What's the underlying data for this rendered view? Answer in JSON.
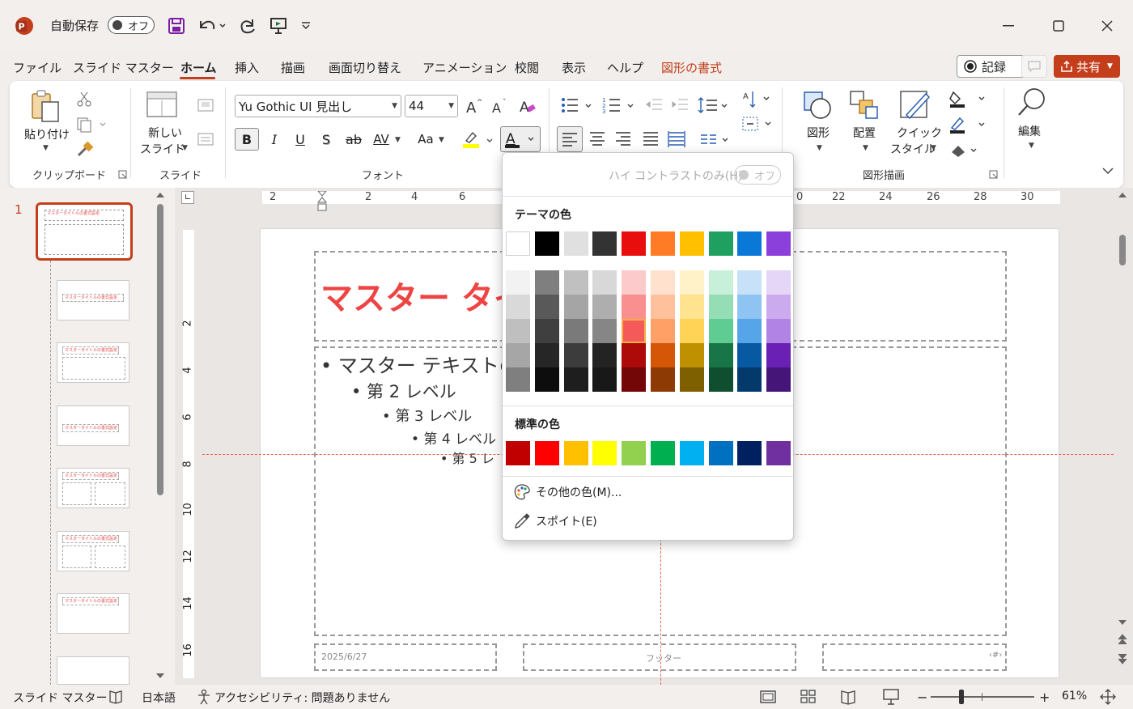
{
  "titlebar": {
    "autosave_label": "自動保存",
    "autosave_state": "オフ",
    "app_icon": "powerpoint-icon",
    "accent": "#c43e1c"
  },
  "menu": {
    "items": [
      "ファイル",
      "スライド マスター",
      "ホーム",
      "挿入",
      "描画",
      "画面切り替え",
      "アニメーション",
      "校閲",
      "表示",
      "ヘルプ",
      "図形の書式"
    ],
    "active": "ホーム",
    "record_label": "記録",
    "share_label": "共有"
  },
  "ribbon": {
    "clipboard": {
      "paste_label": "貼り付け",
      "group_label": "クリップボード"
    },
    "slide": {
      "new_slide_label_1": "新しい",
      "new_slide_label_2": "スライド",
      "group_label": "スライド"
    },
    "font": {
      "font_name": "Yu Gothic UI 見出し",
      "font_size": "44",
      "group_label": "フォント",
      "bold": "B",
      "italic": "I",
      "underline": "U",
      "shadow": "S",
      "strike": "ab",
      "spacing": "AV",
      "case": "Aa"
    },
    "drawing": {
      "shape_label": "図形",
      "arrange_label": "配置",
      "quick_style_1": "クイック",
      "quick_style_2": "スタイル",
      "group_label": "図形描画"
    },
    "edit": {
      "label": "編集"
    }
  },
  "thumbs": {
    "active_index": "1",
    "thumb_title": "マスタータイトルの書式設定"
  },
  "ruler": {
    "top": [
      "2",
      "2",
      "4",
      "6",
      "0",
      "22",
      "24",
      "26",
      "28",
      "30"
    ],
    "left": [
      "2",
      "4",
      "6",
      "8",
      "10",
      "12",
      "14",
      "16"
    ]
  },
  "slide": {
    "title": "マスター タイト",
    "body_l1": "• マスター テキストの書",
    "body_l2": "• 第 2 レベル",
    "body_l3": "• 第 3 レベル",
    "body_l4": "• 第 4 レベル",
    "body_l5": "• 第 5 レ",
    "date": "2025/6/27",
    "footer": "フッター",
    "page": "‹#›"
  },
  "popup": {
    "high_contrast_label": "ハイ コントラストのみ(H)",
    "high_contrast_state": "オフ",
    "theme_label": "テーマの色",
    "standard_label": "標準の色",
    "more_colors": "その他の色(M)...",
    "eyedropper": "スポイト(E)",
    "theme_top": [
      "#ffffff",
      "#000000",
      "#e0e0e0",
      "#333333",
      "#e80e0e",
      "#ff7b25",
      "#ffc000",
      "#20a060",
      "#0a78d7",
      "#8b3fdb"
    ],
    "theme_shades": [
      [
        "#f2f2f2",
        "#7f7f7f",
        "#c0c0c0",
        "#d8d8d8",
        "#fccaca",
        "#ffe1ce",
        "#fff1c8",
        "#c8efd9",
        "#c6e1f8",
        "#e5d5f6"
      ],
      [
        "#d9d9d9",
        "#595959",
        "#a5a5a5",
        "#aeaeae",
        "#f98f8f",
        "#ffc19b",
        "#ffe38f",
        "#94ddb5",
        "#8fc3f1",
        "#cbabed"
      ],
      [
        "#bfbfbf",
        "#3f3f3f",
        "#7a7a7a",
        "#868686",
        "#f55a5a",
        "#ffa167",
        "#ffd456",
        "#5fcc92",
        "#57a5e9",
        "#b183e5"
      ],
      [
        "#a6a6a6",
        "#262626",
        "#3c3c3c",
        "#232323",
        "#ad0a0a",
        "#d55607",
        "#bf9000",
        "#187548",
        "#075aa2",
        "#6a20b5"
      ],
      [
        "#7f7f7f",
        "#0d0d0d",
        "#1e1e1e",
        "#181818",
        "#730707",
        "#8e3a05",
        "#7f6000",
        "#104e30",
        "#04396c",
        "#461578"
      ]
    ],
    "standard": [
      "#c00000",
      "#ff0000",
      "#ffc000",
      "#ffff00",
      "#92d050",
      "#00b050",
      "#00b0f0",
      "#0070c0",
      "#002060",
      "#7030a0"
    ],
    "selected_color": "#f55a5a"
  },
  "status": {
    "view": "スライド マスター",
    "lang": "日本語",
    "accessibility": "アクセシビリティ: 問題ありません",
    "zoom": "61%"
  }
}
